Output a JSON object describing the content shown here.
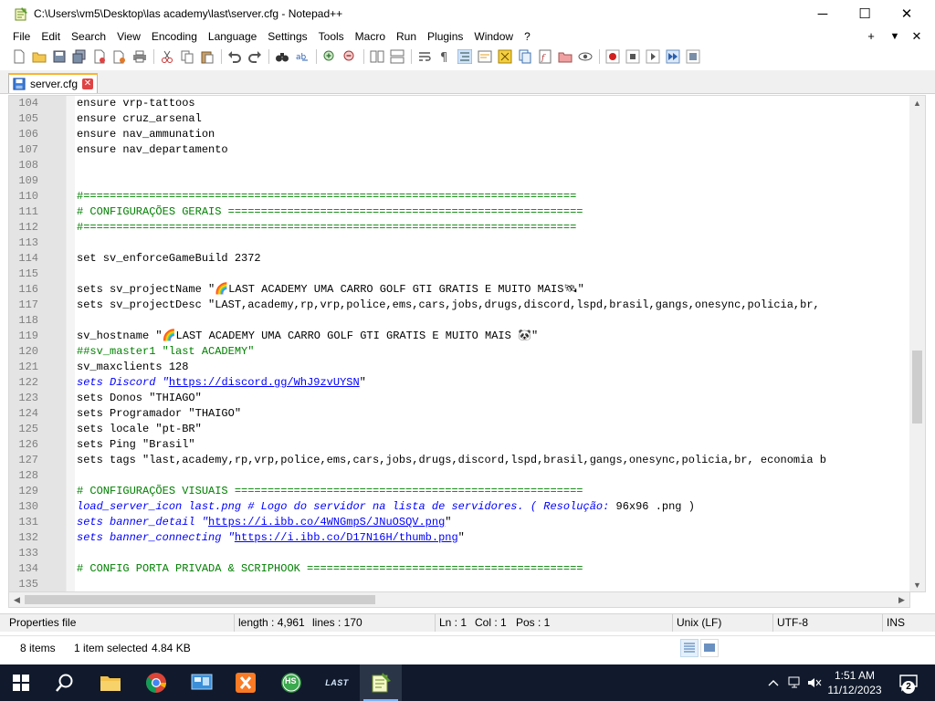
{
  "window": {
    "title": "C:\\Users\\vm5\\Desktop\\las academy\\last\\server.cfg - Notepad++",
    "minimize_glyph": "─",
    "maximize_glyph": "☐",
    "close_glyph": "✕"
  },
  "menu": {
    "items": [
      "File",
      "Edit",
      "Search",
      "View",
      "Encoding",
      "Language",
      "Settings",
      "Tools",
      "Macro",
      "Run",
      "Plugins",
      "Window",
      "?"
    ],
    "right_plus": "+",
    "right_down": "▼",
    "right_close": "✕"
  },
  "tab": {
    "label": "server.cfg",
    "close": "✕"
  },
  "colors": {
    "comment": "#008000",
    "keyword": "#0000ff",
    "line_number": "#808080",
    "gutter": "#e4e4e4",
    "tab_accent": "#fab32b",
    "taskbar": "#101a2c"
  },
  "editor": {
    "lines": [
      {
        "n": "104",
        "segs": [
          {
            "t": "ensure vrp-tattoos",
            "c": ""
          }
        ]
      },
      {
        "n": "105",
        "segs": [
          {
            "t": "ensure cruz_arsenal",
            "c": ""
          }
        ]
      },
      {
        "n": "106",
        "segs": [
          {
            "t": "ensure nav_ammunation",
            "c": ""
          }
        ]
      },
      {
        "n": "107",
        "segs": [
          {
            "t": "ensure nav_departamento",
            "c": ""
          }
        ]
      },
      {
        "n": "108",
        "segs": []
      },
      {
        "n": "109",
        "segs": []
      },
      {
        "n": "110",
        "segs": [
          {
            "t": "#===========================================================================",
            "c": "c-comment"
          }
        ]
      },
      {
        "n": "111",
        "segs": [
          {
            "t": "# CONFIGURAÇÕES GERAIS ======================================================",
            "c": "c-comment"
          }
        ]
      },
      {
        "n": "112",
        "segs": [
          {
            "t": "#===========================================================================",
            "c": "c-comment"
          }
        ]
      },
      {
        "n": "113",
        "segs": []
      },
      {
        "n": "114",
        "segs": [
          {
            "t": "set sv_enforceGameBuild 2372",
            "c": ""
          }
        ]
      },
      {
        "n": "115",
        "segs": []
      },
      {
        "n": "116",
        "segs": [
          {
            "t": "sets sv_projectName \"🌈LAST ACADEMY UMA CARRO GOLF GTI GRATIS E MUITO MAIS🛰\"",
            "c": ""
          }
        ]
      },
      {
        "n": "117",
        "segs": [
          {
            "t": "sets sv_projectDesc \"LAST,academy,rp,vrp,police,ems,cars,jobs,drugs,discord,lspd,brasil,gangs,onesync,policia,br,",
            "c": ""
          }
        ]
      },
      {
        "n": "118",
        "segs": []
      },
      {
        "n": "119",
        "segs": [
          {
            "t": "sv_hostname \"🌈LAST ACADEMY UMA CARRO GOLF GTI GRATIS E MUITO MAIS 🐼\"",
            "c": ""
          }
        ]
      },
      {
        "n": "120",
        "segs": [
          {
            "t": "##sv_master1 \"last ACADEMY\"",
            "c": "c-comment"
          }
        ]
      },
      {
        "n": "121",
        "segs": [
          {
            "t": "sv_maxclients 128",
            "c": ""
          }
        ]
      },
      {
        "n": "122",
        "segs": [
          {
            "t": "sets Discord \"",
            "c": "c-kw"
          },
          {
            "t": "https",
            "c": "c-ul"
          },
          {
            "t": "://discord.gg/WhJ9zvUYSN",
            "c": "c-ul"
          },
          {
            "t": "\"",
            "c": ""
          }
        ]
      },
      {
        "n": "123",
        "segs": [
          {
            "t": "sets Donos \"THIAGO\"",
            "c": ""
          }
        ]
      },
      {
        "n": "124",
        "segs": [
          {
            "t": "sets Programador \"THAIGO\"",
            "c": ""
          }
        ]
      },
      {
        "n": "125",
        "segs": [
          {
            "t": "sets locale \"pt-BR\"",
            "c": ""
          }
        ]
      },
      {
        "n": "126",
        "segs": [
          {
            "t": "sets Ping \"Brasil\"",
            "c": ""
          }
        ]
      },
      {
        "n": "127",
        "segs": [
          {
            "t": "sets tags \"last,academy,rp,vrp,police,ems,cars,jobs,drugs,discord,lspd,brasil,gangs,onesync,policia,br, economia b",
            "c": ""
          }
        ]
      },
      {
        "n": "128",
        "segs": []
      },
      {
        "n": "129",
        "segs": [
          {
            "t": "# CONFIGURAÇÕES VISUAIS =====================================================",
            "c": "c-comment"
          }
        ]
      },
      {
        "n": "130",
        "segs": [
          {
            "t": "load_server_icon last.png # Logo do servidor na lista de servidores. ( Resolução: ",
            "c": "c-kw"
          },
          {
            "t": "96x96 .png )",
            "c": ""
          }
        ]
      },
      {
        "n": "131",
        "segs": [
          {
            "t": "sets banner_detail \"",
            "c": "c-kw"
          },
          {
            "t": "https://i.ibb.co/4WNGmpS/JNuOSQV.png",
            "c": "c-ul"
          },
          {
            "t": "\"",
            "c": ""
          }
        ]
      },
      {
        "n": "132",
        "segs": [
          {
            "t": "sets banner_connecting \"",
            "c": "c-kw"
          },
          {
            "t": "https://i.ibb.co/D17N16H/thumb.png",
            "c": "c-ul"
          },
          {
            "t": "\"",
            "c": ""
          }
        ]
      },
      {
        "n": "133",
        "segs": []
      },
      {
        "n": "134",
        "segs": [
          {
            "t": "# CONFIG PORTA PRIVADA & SCRIPHOOK ==========================================",
            "c": "c-comment"
          }
        ]
      },
      {
        "n": "135",
        "segs": []
      }
    ]
  },
  "statusbar": {
    "file_type": "Properties file",
    "length": "length : 4,961",
    "lines": "lines : 170",
    "ln": "Ln : 1",
    "col": "Col : 1",
    "pos": "Pos : 1",
    "eol": "Unix (LF)",
    "encoding": "UTF-8",
    "mode": "INS"
  },
  "explorer": {
    "items": "8 items",
    "selected": "1 item selected",
    "size": "4.84 KB"
  },
  "taskbar": {
    "time": "1:51 AM",
    "date": "11/12/2023",
    "notifications": "2",
    "hs_label": "HS",
    "last_label": "LAST"
  }
}
